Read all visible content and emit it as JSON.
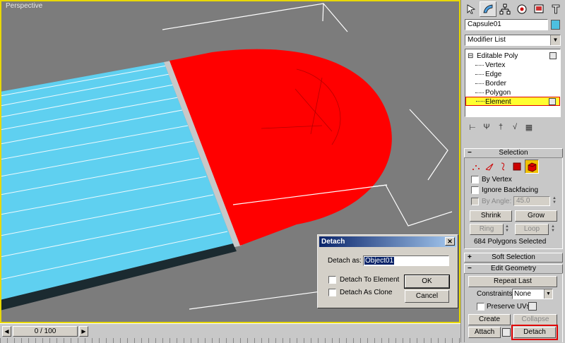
{
  "viewport": {
    "label": "Perspective",
    "background": "#7c7c7c",
    "selected_color": "#ff0000",
    "object_color": "#5fd0f0"
  },
  "timeline": {
    "frame_display": "0 / 100",
    "prev_icon": "arrow-left-icon",
    "next_icon": "arrow-right-icon"
  },
  "panel": {
    "tabs": [
      "create-icon",
      "modify-icon",
      "hierarchy-icon",
      "motion-icon",
      "display-icon",
      "utilities-icon"
    ],
    "object_name": "Capsule01",
    "object_color": "#4cc0e0",
    "modifier_list": "Modifier List",
    "stack": {
      "root": "Editable Poly",
      "items": [
        "Vertex",
        "Edge",
        "Border",
        "Polygon",
        "Element"
      ],
      "selected": "Element"
    },
    "selection": {
      "title": "Selection",
      "by_vertex": "By Vertex",
      "ignore_backfacing": "Ignore Backfacing",
      "by_angle": "By Angle:",
      "angle_value": "45.0",
      "shrink": "Shrink",
      "grow": "Grow",
      "ring": "Ring",
      "loop": "Loop",
      "status": "684 Polygons Selected"
    },
    "soft_selection": {
      "title": "Soft Selection"
    },
    "edit_geometry": {
      "title": "Edit Geometry",
      "repeat_last": "Repeat Last",
      "constraints_label": "Constraints:",
      "constraints_value": "None",
      "preserve_uvs": "Preserve UVs",
      "create": "Create",
      "collapse": "Collapse",
      "attach": "Attach",
      "detach": "Detach"
    },
    "accent": "#e00000"
  },
  "dialog": {
    "title": "Detach",
    "detach_as_label": "Detach as:",
    "detach_as_value": "Object01",
    "detach_to_element": "Detach To Element",
    "detach_as_clone": "Detach As Clone",
    "ok": "OK",
    "cancel": "Cancel"
  }
}
